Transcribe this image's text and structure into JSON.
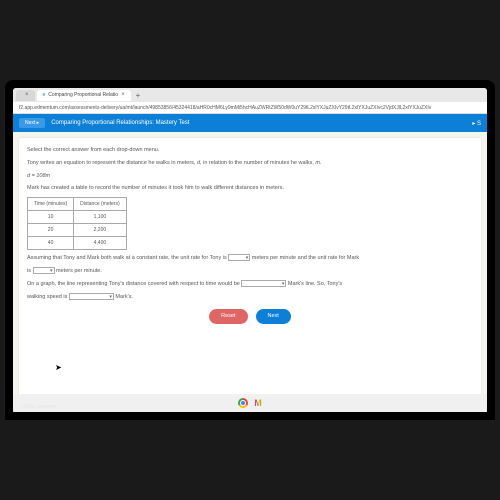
{
  "tabs": {
    "t1": "",
    "t2": "Comparing Proportional Relatio",
    "add": "+"
  },
  "url": "f2.app.edmentum.com/assessments-delivery/ua/mt/launch/49853856/45324418/aHR0cHM6Ly9mMi5hcHAuZWRtZW50dW0uY29tL2xlYXJuZXIvY29tL2xlYXJuZXIvc2VjdXJlL2xlYXJuZXIv",
  "header": {
    "next": "Next ▸",
    "title": "Comparing Proportional Relationships: Mastery Test",
    "right": "▸ S"
  },
  "q": {
    "instr": "Select the correct answer from each drop-down menu.",
    "p1a": "Tony writes an equation to represent the distance he walks in meters, ",
    "p1b": "d,",
    "p1c": " in relation to the number of minutes he walks, ",
    "p1d": "m.",
    "eq": "d = 108m",
    "p2": "Mark has created a table to record the number of minutes it took him to walk different distances in meters.",
    "th1": "Time (minutes)",
    "th2": "Distance (meters)",
    "r1c1": "10",
    "r1c2": "1,100",
    "r2c1": "20",
    "r2c2": "2,200",
    "r3c1": "40",
    "r3c2": "4,400",
    "s1": "Assuming that Tony and Mark both walk at a constant rate, the unit rate for Tony is ",
    "s2": " meters per minute and the unit rate for Mark",
    "s3": "is ",
    "s4": " meters per minute.",
    "s5": "On a graph, the line representing Tony's distance covered with respect to time would be ",
    "s6": " Mark's line. So, Tony's",
    "s7": "walking speed is ",
    "s8": " Mark's."
  },
  "btns": {
    "reset": "Reset",
    "next": "Next"
  },
  "footer": "l rights reserved.",
  "gmail": "M"
}
